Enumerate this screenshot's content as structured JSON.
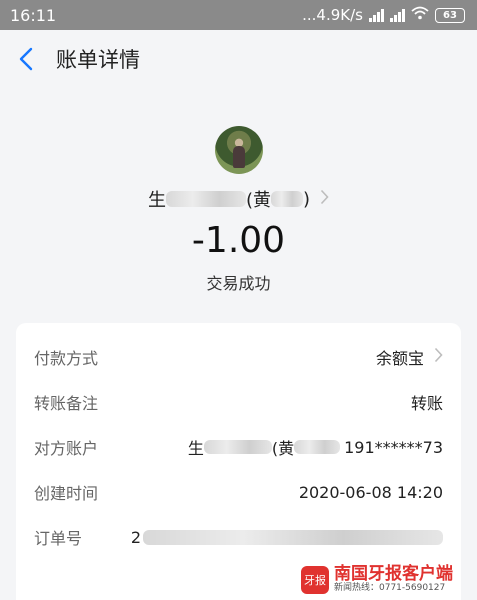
{
  "status_bar": {
    "time": "16:11",
    "network_speed": "...4.9K/s",
    "battery": "63"
  },
  "nav": {
    "title": "账单详情"
  },
  "transaction": {
    "payee_prefix": "生",
    "payee_middle": "(黄",
    "payee_suffix": ")",
    "amount": "-1.00",
    "status": "交易成功"
  },
  "details": {
    "rows": [
      {
        "label": "付款方式",
        "value": "余额宝"
      },
      {
        "label": "转账备注",
        "value": "转账"
      },
      {
        "label": "对方账户",
        "value_prefix": "生",
        "value_middle": "(黄",
        "value_suffix": "191******73"
      },
      {
        "label": "创建时间",
        "value": "2020-06-08 14:20"
      },
      {
        "label": "订单号",
        "value_prefix": "2"
      }
    ]
  },
  "watermark": {
    "logo": "牙报",
    "main": "南国牙报客户端",
    "sub": "新闻热线：0771-5690127"
  },
  "colors": {
    "status_bar_bg": "#8a8a8a",
    "page_bg": "#f4f5f7",
    "accent_blue": "#1677ff",
    "watermark_red": "#e0322f"
  }
}
